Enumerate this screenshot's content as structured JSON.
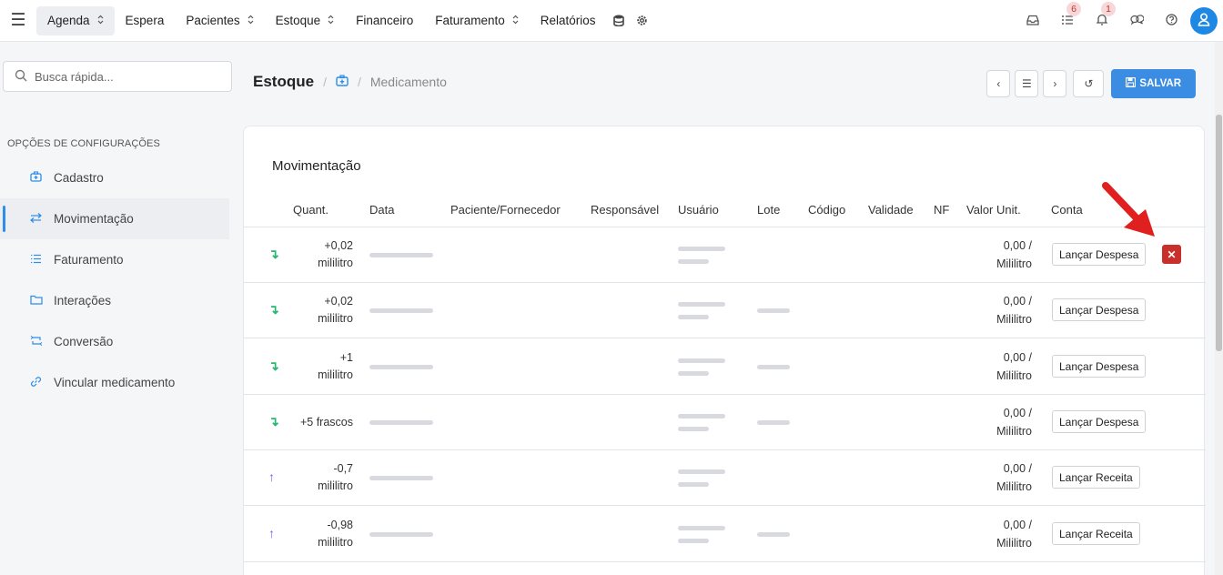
{
  "nav": {
    "items": [
      {
        "label": "Agenda",
        "dropdown": true,
        "active": true
      },
      {
        "label": "Espera",
        "dropdown": false
      },
      {
        "label": "Pacientes",
        "dropdown": true
      },
      {
        "label": "Estoque",
        "dropdown": true
      },
      {
        "label": "Financeiro",
        "dropdown": false
      },
      {
        "label": "Faturamento",
        "dropdown": true
      },
      {
        "label": "Relatórios",
        "dropdown": false
      }
    ],
    "extra_icons": [
      "database-icon",
      "gear-icon"
    ],
    "right_icons": [
      {
        "name": "inbox-icon",
        "badge": ""
      },
      {
        "name": "tasks-icon",
        "badge": "6"
      },
      {
        "name": "bell-icon",
        "badge": "1"
      },
      {
        "name": "chat-icon",
        "badge": ""
      },
      {
        "name": "help-icon",
        "badge": ""
      }
    ],
    "avatar_icon": "user-icon"
  },
  "search": {
    "placeholder": "Busca rápida..."
  },
  "sidebar": {
    "heading": "OPÇÕES DE CONFIGURAÇÕES",
    "items": [
      {
        "label": "Cadastro",
        "icon": "medkit-icon",
        "active": false
      },
      {
        "label": "Movimentação",
        "icon": "transfer-icon",
        "active": true
      },
      {
        "label": "Faturamento",
        "icon": "list-icon",
        "active": false
      },
      {
        "label": "Interações",
        "icon": "folder-icon",
        "active": false
      },
      {
        "label": "Conversão",
        "icon": "convert-icon",
        "active": false
      },
      {
        "label": "Vincular medicamento",
        "icon": "link-icon",
        "active": false
      }
    ]
  },
  "breadcrumb": {
    "main": "Estoque",
    "sep": "/",
    "current": "Medicamento"
  },
  "actions": {
    "save_label": "SALVAR"
  },
  "table": {
    "title": "Movimentação",
    "headers": [
      "Quant.",
      "Data",
      "Paciente/Fornecedor",
      "Responsável",
      "Usuário",
      "Lote",
      "Código",
      "Validade",
      "NF",
      "Valor Unit.",
      "Conta"
    ],
    "rows": [
      {
        "direction": "in",
        "qty_value": "+0,02",
        "qty_unit": "mililitro",
        "has_lote": false,
        "val_line1": "0,00 /",
        "val_line2": "Mililitro",
        "button": "Lançar Despesa",
        "delete": true
      },
      {
        "direction": "in",
        "qty_value": "+0,02",
        "qty_unit": "mililitro",
        "has_lote": true,
        "val_line1": "0,00 /",
        "val_line2": "Mililitro",
        "button": "Lançar Despesa",
        "delete": false
      },
      {
        "direction": "in",
        "qty_value": "+1",
        "qty_unit": "mililitro",
        "has_lote": true,
        "val_line1": "0,00 /",
        "val_line2": "Mililitro",
        "button": "Lançar Despesa",
        "delete": false
      },
      {
        "direction": "in",
        "qty_value": "+5 frascos",
        "qty_unit": "",
        "has_lote": true,
        "val_line1": "0,00 /",
        "val_line2": "Mililitro",
        "button": "Lançar Despesa",
        "delete": false
      },
      {
        "direction": "out",
        "qty_value": "-0,7",
        "qty_unit": "mililitro",
        "has_lote": false,
        "val_line1": "0,00 /",
        "val_line2": "Mililitro",
        "button": "Lançar Receita",
        "delete": false
      },
      {
        "direction": "out",
        "qty_value": "-0,98",
        "qty_unit": "mililitro",
        "has_lote": true,
        "val_line1": "0,00 /",
        "val_line2": "Mililitro",
        "button": "Lançar Receita",
        "delete": false
      }
    ]
  },
  "colors": {
    "accent": "#3b8de4",
    "delete": "#c9302c",
    "pointer": "#e0201e",
    "in": "#2bb673",
    "out": "#7b5cf0"
  }
}
